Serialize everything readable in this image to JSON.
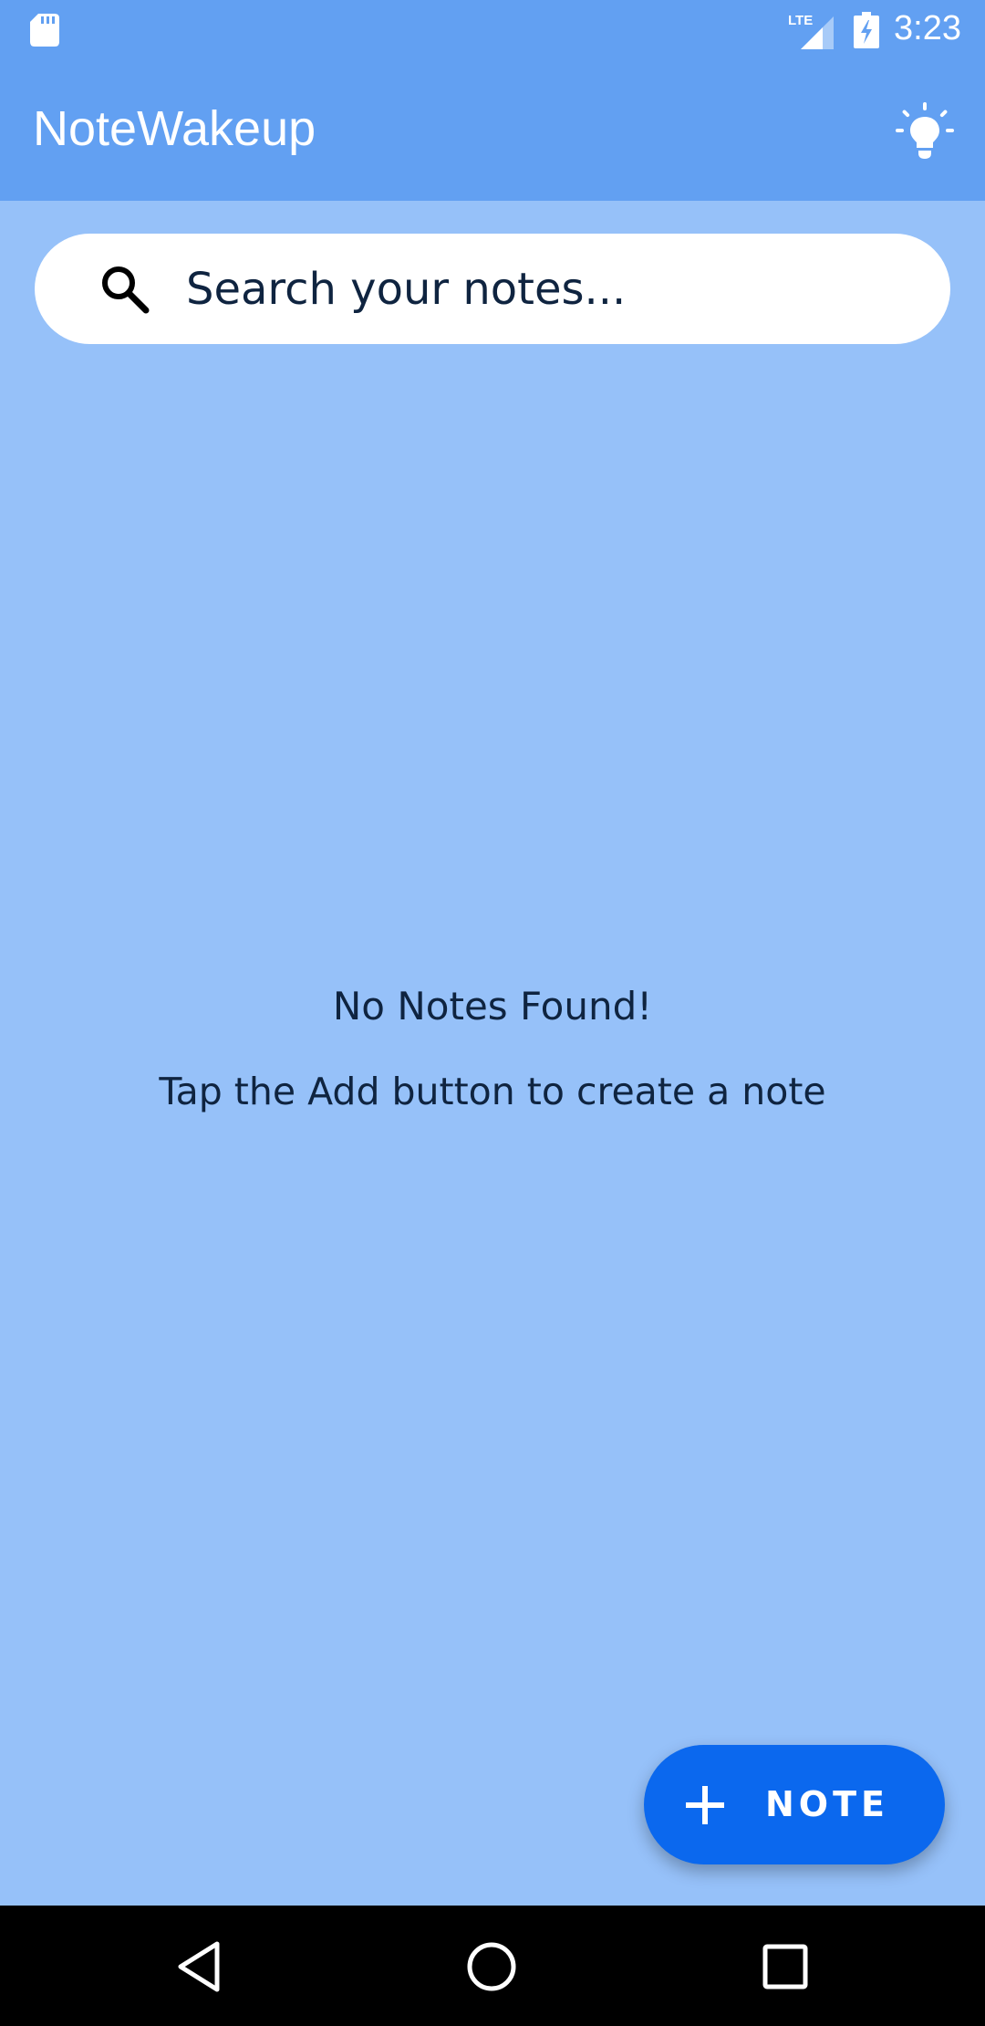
{
  "status_bar": {
    "time": "3:23",
    "icons": [
      "sd-card-icon",
      "lte-signal-icon",
      "battery-charging-icon"
    ]
  },
  "app_bar": {
    "title": "NoteWakeup",
    "action_icon": "lightbulb-icon"
  },
  "search": {
    "placeholder": "Search your notes...",
    "value": "",
    "icon": "search-icon"
  },
  "empty_state": {
    "title": "No Notes Found!",
    "subtitle": "Tap the Add button to create a note"
  },
  "fab": {
    "icon": "plus-icon",
    "label": "NOTE"
  },
  "nav_bar": {
    "icons": [
      "back-icon",
      "home-icon",
      "recents-icon"
    ]
  },
  "colors": {
    "primary": "#62a0f2",
    "background": "#96c1f9",
    "accent": "#0b68ee",
    "text_dark": "#0f2440"
  }
}
